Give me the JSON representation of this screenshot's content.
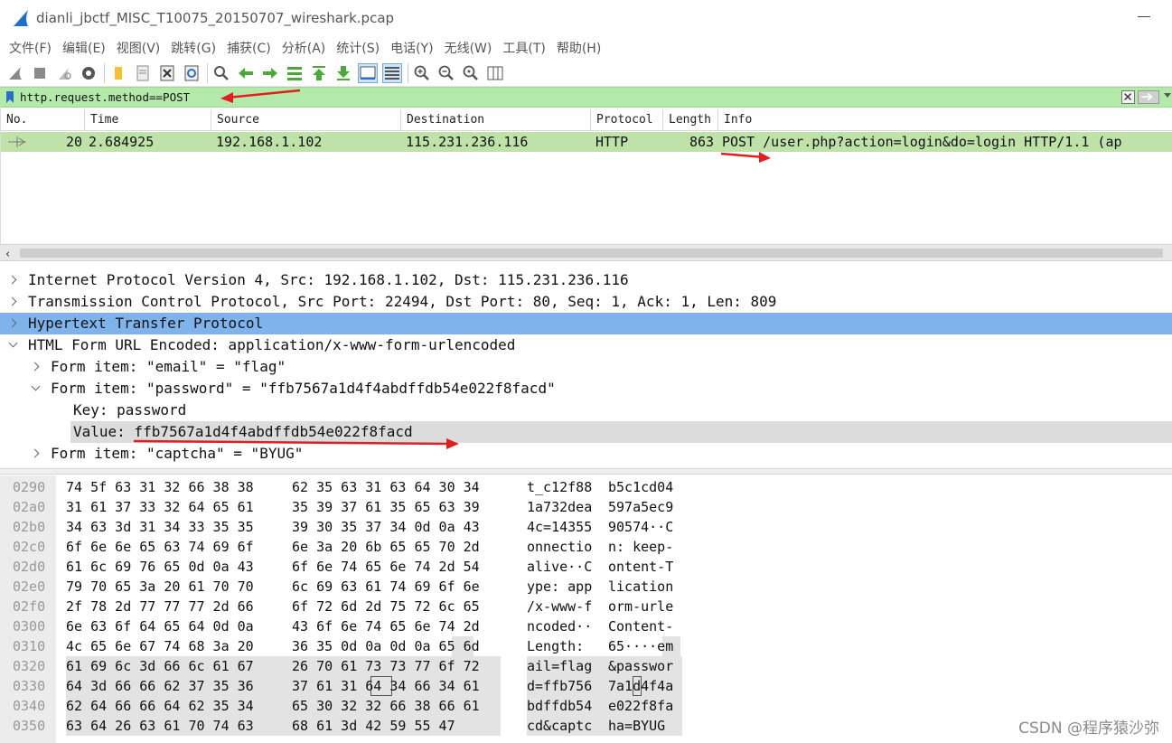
{
  "window": {
    "title": "dianli_jbctf_MISC_T10075_20150707_wireshark.pcap"
  },
  "menu": [
    "文件(F)",
    "编辑(E)",
    "视图(V)",
    "跳转(G)",
    "捕获(C)",
    "分析(A)",
    "统计(S)",
    "电话(Y)",
    "无线(W)",
    "工具(T)",
    "帮助(H)"
  ],
  "filter": {
    "value": "http.request.method==POST"
  },
  "packet_list": {
    "columns": [
      "No.",
      "Time",
      "Source",
      "Destination",
      "Protocol",
      "Length",
      "Info"
    ],
    "rows": [
      {
        "no": "20",
        "time": "2.684925",
        "source": "192.168.1.102",
        "destination": "115.231.236.116",
        "protocol": "HTTP",
        "length": "863",
        "info": "POST /user.php?action=login&do=login HTTP/1.1  (ap"
      }
    ]
  },
  "details": [
    {
      "text": "Internet Protocol Version 4, Src: 192.168.1.102, Dst: 115.231.236.116",
      "state": "collapsed"
    },
    {
      "text": "Transmission Control Protocol, Src Port: 22494, Dst Port: 80, Seq: 1, Ack: 1, Len: 809",
      "state": "collapsed"
    },
    {
      "text": "Hypertext Transfer Protocol",
      "state": "collapsed"
    },
    {
      "text": "HTML Form URL Encoded: application/x-www-form-urlencoded",
      "state": "expanded"
    },
    {
      "text": "Form item: \"email\" = \"flag\"",
      "state": "collapsed"
    },
    {
      "text": "Form item: \"password\" = \"ffb7567a1d4f4abdffdb54e022f8facd\"",
      "state": "expanded"
    },
    {
      "text": "Key: password",
      "state": "leaf"
    },
    {
      "text": "Value: ffb7567a1d4f4abdffdb54e022f8facd",
      "state": "leaf"
    },
    {
      "text": "Form item: \"captcha\" = \"BYUG\"",
      "state": "collapsed"
    }
  ],
  "bytes": [
    {
      "offset": "0290",
      "hex1": "74 5f 63 31 32 66 38 38",
      "hex2": "62 35 63 31 63 64 30 34",
      "ascii1": "t_c12f88",
      "ascii2": "b5c1cd04"
    },
    {
      "offset": "02a0",
      "hex1": "31 61 37 33 32 64 65 61",
      "hex2": "35 39 37 61 35 65 63 39",
      "ascii1": "1a732dea",
      "ascii2": "597a5ec9"
    },
    {
      "offset": "02b0",
      "hex1": "34 63 3d 31 34 33 35 35",
      "hex2": "39 30 35 37 34 0d 0a 43",
      "ascii1": "4c=14355",
      "ascii2": "90574··C"
    },
    {
      "offset": "02c0",
      "hex1": "6f 6e 6e 65 63 74 69 6f",
      "hex2": "6e 3a 20 6b 65 65 70 2d",
      "ascii1": "onnectio",
      "ascii2": "n: keep-"
    },
    {
      "offset": "02d0",
      "hex1": "61 6c 69 76 65 0d 0a 43",
      "hex2": "6f 6e 74 65 6e 74 2d 54",
      "ascii1": "alive··C",
      "ascii2": "ontent-T"
    },
    {
      "offset": "02e0",
      "hex1": "79 70 65 3a 20 61 70 70",
      "hex2": "6c 69 63 61 74 69 6f 6e",
      "ascii1": "ype: app",
      "ascii2": "lication"
    },
    {
      "offset": "02f0",
      "hex1": "2f 78 2d 77 77 77 2d 66",
      "hex2": "6f 72 6d 2d 75 72 6c 65",
      "ascii1": "/x-www-f",
      "ascii2": "orm-urle"
    },
    {
      "offset": "0300",
      "hex1": "6e 63 6f 64 65 64 0d 0a",
      "hex2": "43 6f 6e 74 65 6e 74 2d",
      "ascii1": "ncoded··",
      "ascii2": "Content-"
    },
    {
      "offset": "0310",
      "hex1": "4c 65 6e 67 74 68 3a 20",
      "hex2": "36 35 0d 0a 0d 0a 65 6d",
      "ascii1": "Length: ",
      "ascii2": "65····em"
    },
    {
      "offset": "0320",
      "hex1": "61 69 6c 3d 66 6c 61 67",
      "hex2": "26 70 61 73 73 77 6f 72",
      "ascii1": "ail=flag",
      "ascii2": "&passwor"
    },
    {
      "offset": "0330",
      "hex1": "64 3d 66 66 62 37 35 36",
      "hex2": "37 61 31 64 34 66 34 61",
      "ascii1": "d=ffb756",
      "ascii2": "7a1d4f4a"
    },
    {
      "offset": "0340",
      "hex1": "62 64 66 66 64 62 35 34",
      "hex2": "65 30 32 32 66 38 66 61",
      "ascii1": "bdffdb54",
      "ascii2": "e022f8fa"
    },
    {
      "offset": "0350",
      "hex1": "63 64 26 63 61 70 74 63",
      "hex2": "68 61 3d 42 59 55 47",
      "ascii1": "cd&captc",
      "ascii2": "ha=BYUG"
    }
  ],
  "watermark": "CSDN @程序猿沙弥",
  "colors": {
    "filter_bg": "#b3e9a9",
    "row_bg": "#bfe2a9",
    "selected_bg": "#7fb3ec",
    "arrow": "#e02020"
  }
}
